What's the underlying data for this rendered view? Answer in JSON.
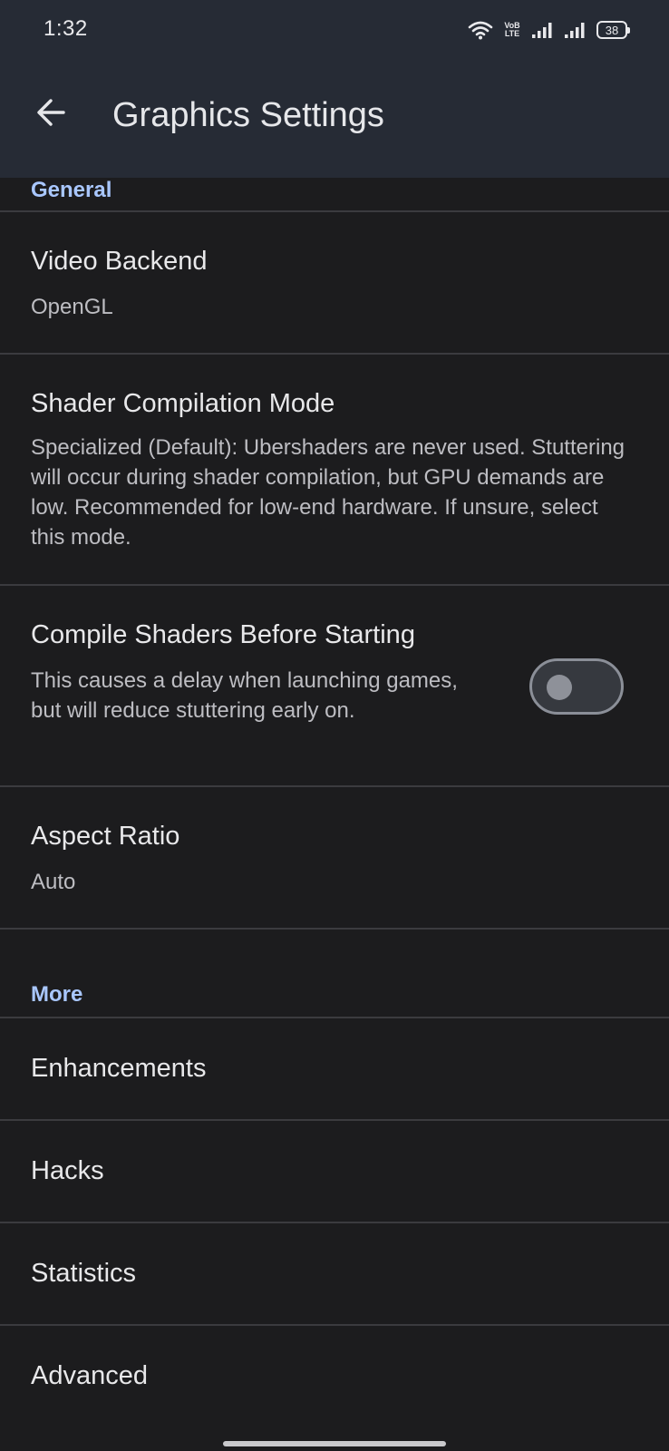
{
  "status_bar": {
    "time": "1:32",
    "volte_line1": "VoB",
    "volte_line2": "LTE",
    "battery": "38",
    "wifi_icon": "wifi-icon",
    "signal_icon": "signal-icon"
  },
  "app_bar": {
    "title": "Graphics Settings",
    "back_icon": "arrow-back-icon"
  },
  "sections": {
    "general": {
      "header": "General",
      "video_backend": {
        "title": "Video Backend",
        "summary": "OpenGL"
      },
      "shader_mode": {
        "title": "Shader Compilation Mode",
        "summary": "Specialized (Default): Ubershaders are never used. Stuttering will occur during shader compilation, but GPU demands are low. Recommended for low-end hardware. If unsure, select this mode."
      },
      "compile_shaders": {
        "title": "Compile Shaders Before Starting",
        "summary": "This causes a delay when launching games, but will reduce stuttering early on.",
        "enabled": false
      },
      "aspect_ratio": {
        "title": "Aspect Ratio",
        "summary": "Auto"
      }
    },
    "more": {
      "header": "More",
      "items": [
        "Enhancements",
        "Hacks",
        "Statistics",
        "Advanced"
      ]
    }
  },
  "colors": {
    "accent": "#a9c7ff",
    "header_bg": "#262b35",
    "background": "#1c1c1e"
  }
}
